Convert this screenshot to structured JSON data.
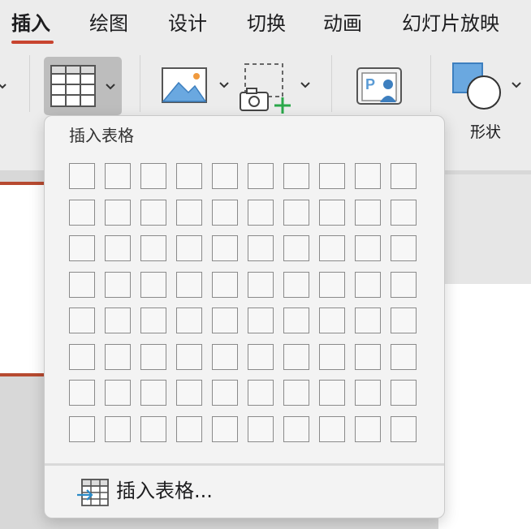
{
  "tabs": [
    {
      "label": "插入",
      "active": true
    },
    {
      "label": "绘图",
      "active": false
    },
    {
      "label": "设计",
      "active": false
    },
    {
      "label": "切换",
      "active": false
    },
    {
      "label": "动画",
      "active": false
    },
    {
      "label": "幻灯片放映",
      "active": false
    }
  ],
  "accent_color": "#c8442f",
  "ribbon": {
    "table_button": {
      "icon": "table-icon"
    },
    "picture_button": {
      "icon": "picture-icon"
    },
    "screenshot_button": {
      "icon": "screenshot-icon"
    },
    "photo_album_button": {
      "icon": "photo-album-icon"
    },
    "shapes_button": {
      "icon": "shapes-icon",
      "label": "形状"
    }
  },
  "insert_table_menu": {
    "title": "插入表格",
    "grid_columns": 10,
    "grid_rows": 8,
    "insert_table_command": {
      "icon": "insert-table-icon",
      "label": "插入表格..."
    }
  }
}
